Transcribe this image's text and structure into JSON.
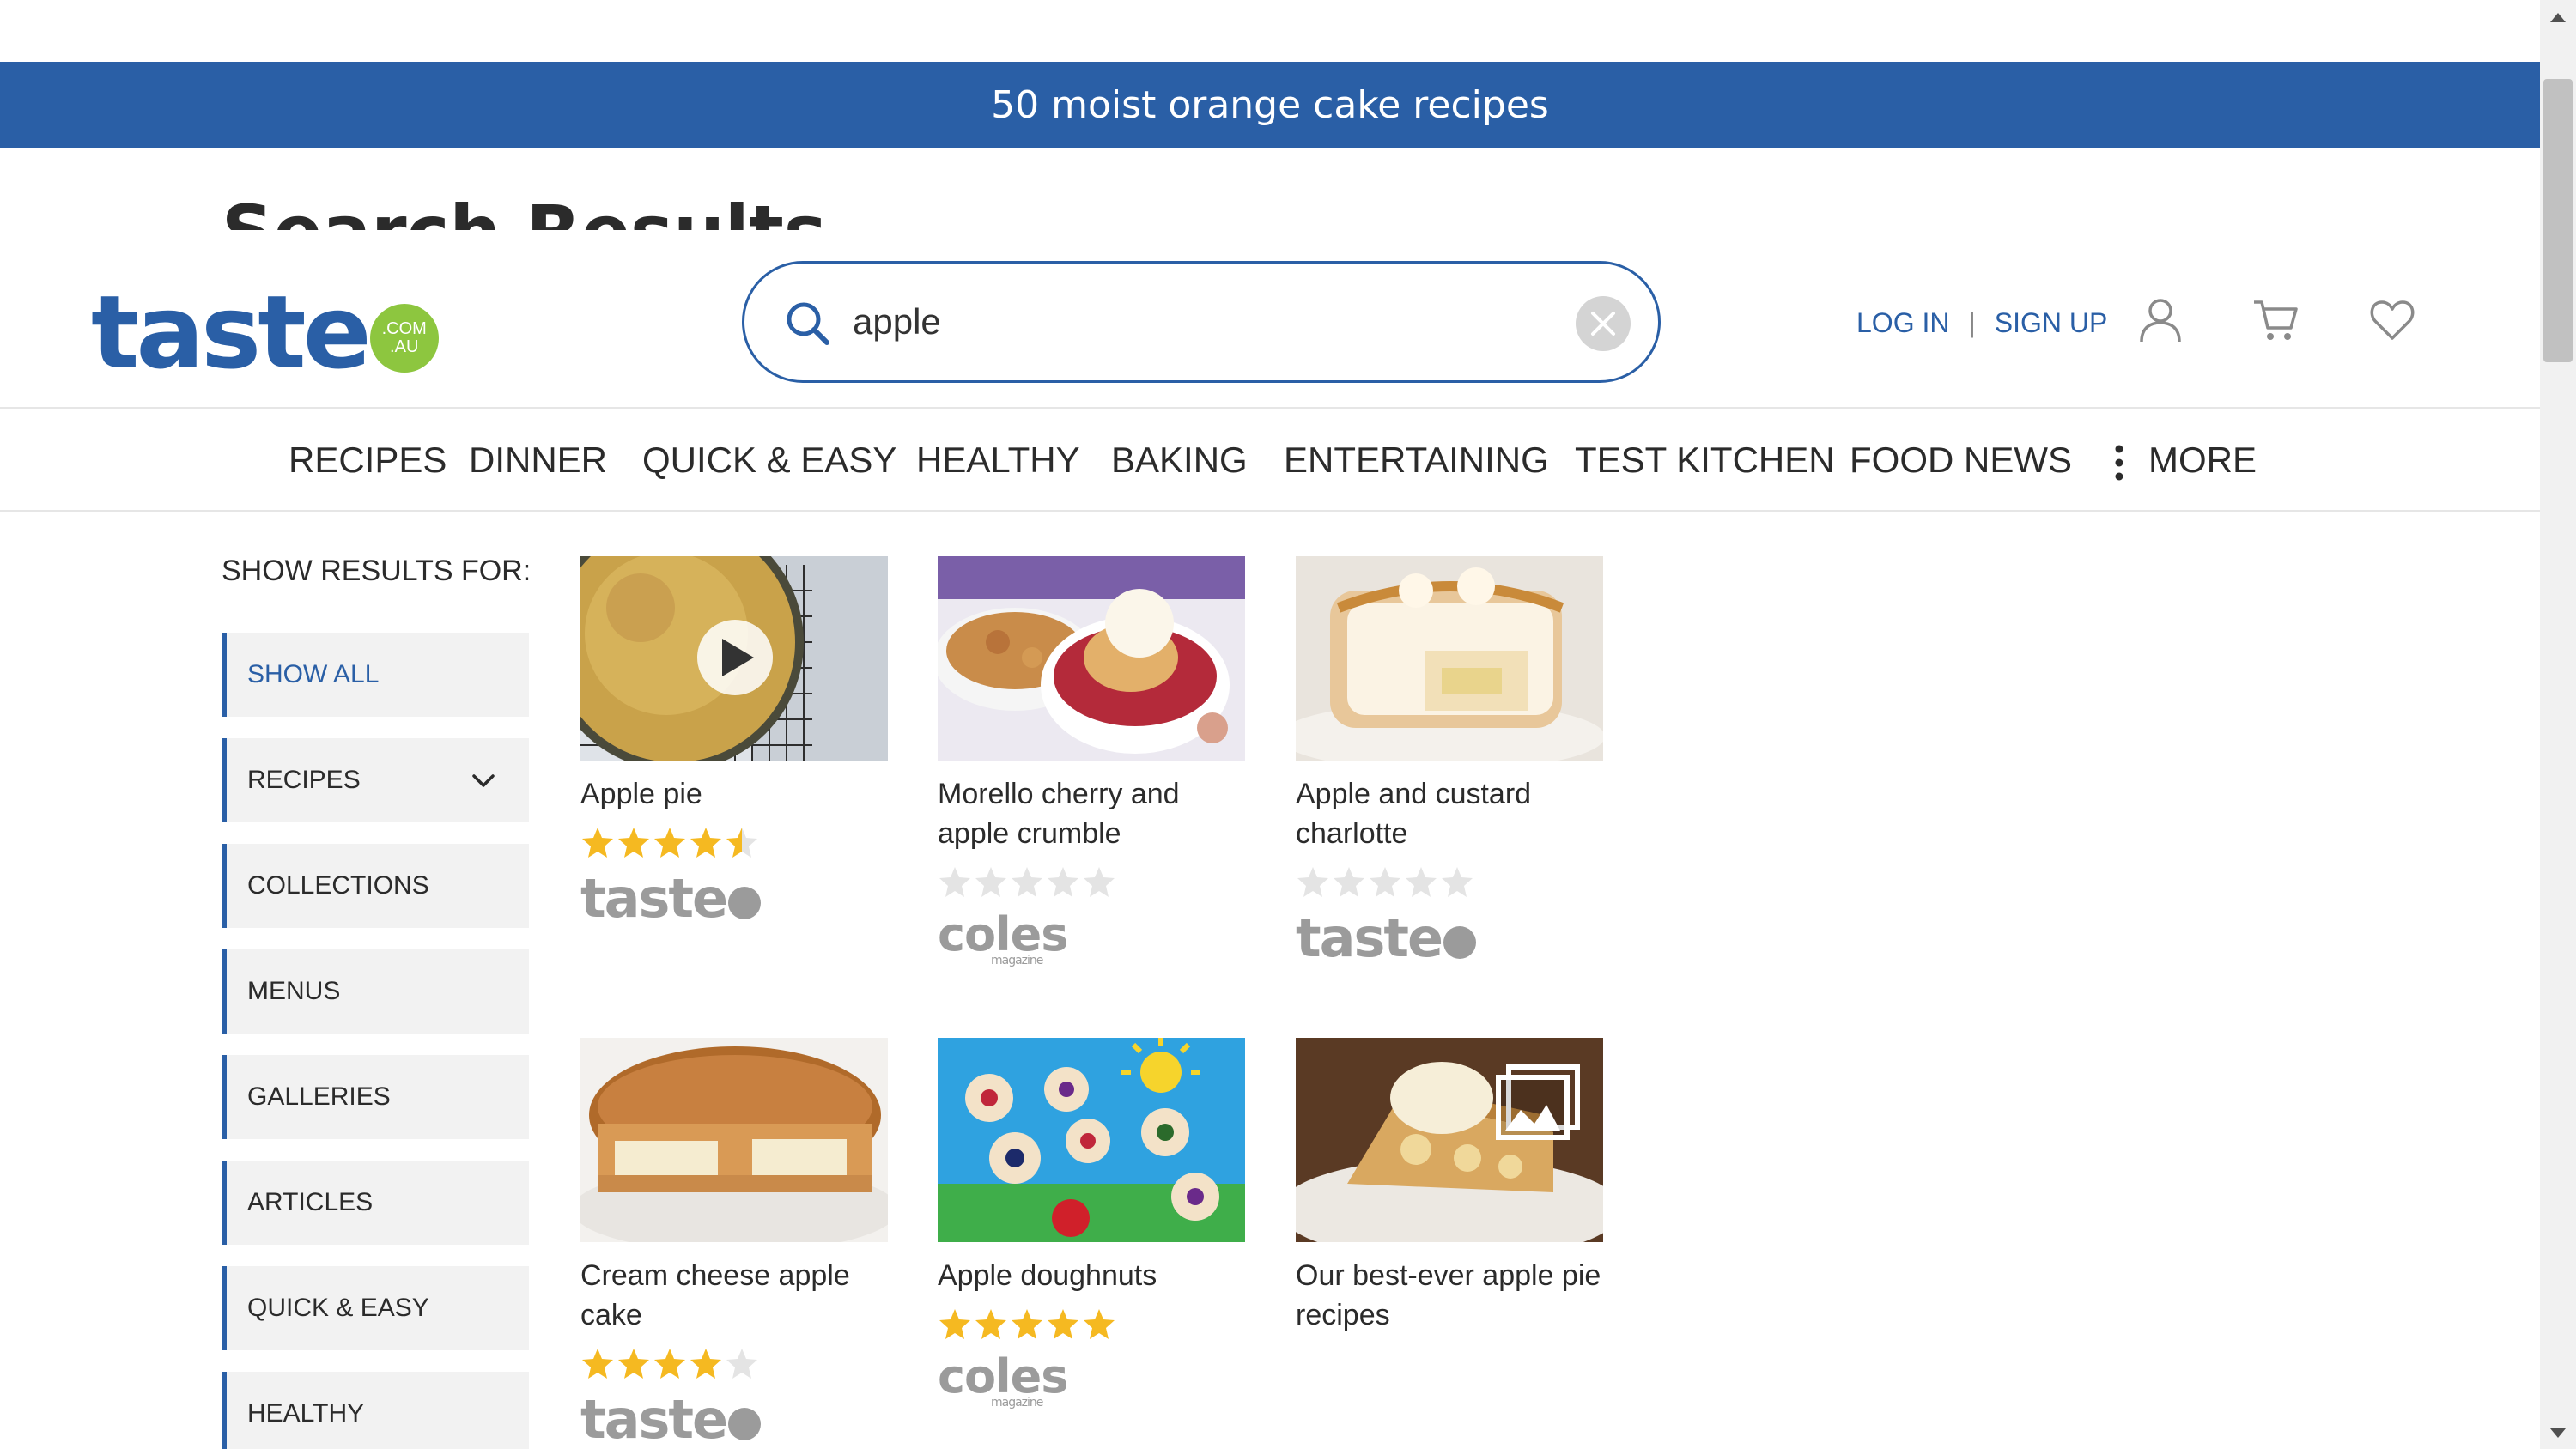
{
  "banner": {
    "text": "50 moist orange cake recipes"
  },
  "behind_title": "Search Results",
  "header": {
    "logo_text": "taste",
    "logo_badge_line1": ".COM",
    "logo_badge_line2": ".AU",
    "search": {
      "value": "apple"
    },
    "login": "LOG IN",
    "separator": "|",
    "signup": "SIGN UP"
  },
  "nav": {
    "items": [
      "RECIPES",
      "DINNER",
      "QUICK & EASY",
      "HEALTHY",
      "BAKING",
      "ENTERTAINING",
      "TEST KITCHEN",
      "FOOD NEWS"
    ],
    "more": "MORE"
  },
  "sidebar": {
    "title": "SHOW RESULTS FOR:",
    "filters": [
      "SHOW ALL",
      "RECIPES",
      "COLLECTIONS",
      "MENUS",
      "GALLERIES",
      "ARTICLES",
      "QUICK & EASY",
      "HEALTHY"
    ]
  },
  "results": [
    {
      "title": "Apple pie",
      "rating": 4.5,
      "brand": "taste",
      "media": "video"
    },
    {
      "title": "Morello cherry and apple crumble",
      "rating": 0,
      "brand": "coles",
      "media": "none"
    },
    {
      "title": "Apple and custard charlotte",
      "rating": 0,
      "brand": "taste",
      "media": "none"
    },
    {
      "title": "Cream cheese apple cake",
      "rating": 4,
      "brand": "taste",
      "media": "none"
    },
    {
      "title": "Apple doughnuts",
      "rating": 5,
      "brand": "coles",
      "media": "none"
    },
    {
      "title": "Our best-ever apple pie recipes",
      "rating": null,
      "brand": null,
      "media": "gallery"
    }
  ],
  "brand_labels": {
    "taste": "taste",
    "coles": "coles",
    "coles_sub": "magazine"
  },
  "colors": {
    "brand_blue": "#2a5fa6",
    "star_gold": "#f5b921",
    "star_empty": "#e4e4e4",
    "logo_green": "#8dc63f"
  }
}
